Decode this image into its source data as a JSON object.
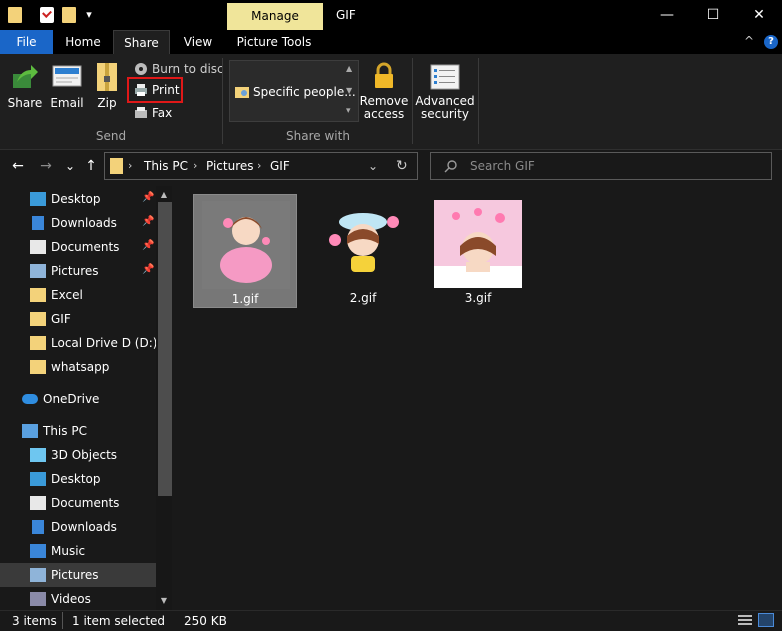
{
  "window": {
    "title": "GIF",
    "manage_tab": "Manage",
    "minimize": "—",
    "maximize": "☐",
    "close": "✕"
  },
  "tabs": [
    {
      "label": "File"
    },
    {
      "label": "Home"
    },
    {
      "label": "Share"
    },
    {
      "label": "View"
    },
    {
      "label": "Picture Tools"
    }
  ],
  "ribbon": {
    "send": {
      "share": "Share",
      "email": "Email",
      "zip": "Zip",
      "burn": "Burn to disc",
      "print": "Print",
      "fax": "Fax",
      "group_label": "Send"
    },
    "share_with": {
      "specific": "Specific people...",
      "remove_access": [
        "Remove",
        "access"
      ],
      "advanced_security": [
        "Advanced",
        "security"
      ],
      "group_label": "Share with"
    },
    "collapse": "^",
    "help": "?"
  },
  "address": {
    "crumbs": [
      "This PC",
      "Pictures",
      "GIF"
    ],
    "back": "←",
    "forward": "→",
    "recent": "⌄",
    "up": "↑",
    "dropdown": "⌄",
    "refresh": "↻",
    "search_placeholder": "Search GIF"
  },
  "sidebar": {
    "items": [
      {
        "label": "Desktop",
        "icon": "desktop-icon",
        "pinned": true
      },
      {
        "label": "Downloads",
        "icon": "downloads-icon",
        "pinned": true
      },
      {
        "label": "Documents",
        "icon": "documents-icon",
        "pinned": true
      },
      {
        "label": "Pictures",
        "icon": "pictures-icon",
        "pinned": true
      },
      {
        "label": "Excel",
        "icon": "folder-icon",
        "pinned": false
      },
      {
        "label": "GIF",
        "icon": "folder-icon",
        "pinned": false
      },
      {
        "label": "Local Drive D (D:)",
        "icon": "folder-icon",
        "pinned": false
      },
      {
        "label": "whatsapp",
        "icon": "folder-icon",
        "pinned": false
      },
      {
        "label": "OneDrive",
        "icon": "cloud-icon",
        "pinned": false
      },
      {
        "label": "This PC",
        "icon": "computer-icon",
        "pinned": false
      },
      {
        "label": "3D Objects",
        "icon": "cube-icon",
        "pinned": false
      },
      {
        "label": "Desktop",
        "icon": "desktop-icon",
        "pinned": false
      },
      {
        "label": "Documents",
        "icon": "documents-icon",
        "pinned": false
      },
      {
        "label": "Downloads",
        "icon": "downloads-icon",
        "pinned": false
      },
      {
        "label": "Music",
        "icon": "music-icon",
        "pinned": false
      },
      {
        "label": "Pictures",
        "icon": "pictures-icon",
        "pinned": false
      },
      {
        "label": "Videos",
        "icon": "videos-icon",
        "pinned": false
      }
    ],
    "pin_glyph": "📌"
  },
  "files": [
    {
      "name": "1.gif",
      "selected": true
    },
    {
      "name": "2.gif",
      "selected": false
    },
    {
      "name": "3.gif",
      "selected": false
    }
  ],
  "status": {
    "items": "3 items",
    "selection": "1 item selected",
    "size": "250 KB"
  },
  "colors": {
    "accent": "#1a66c8",
    "manage_tab": "#f0e59a",
    "highlight": "#e01818",
    "folder": "#f3d27a"
  }
}
